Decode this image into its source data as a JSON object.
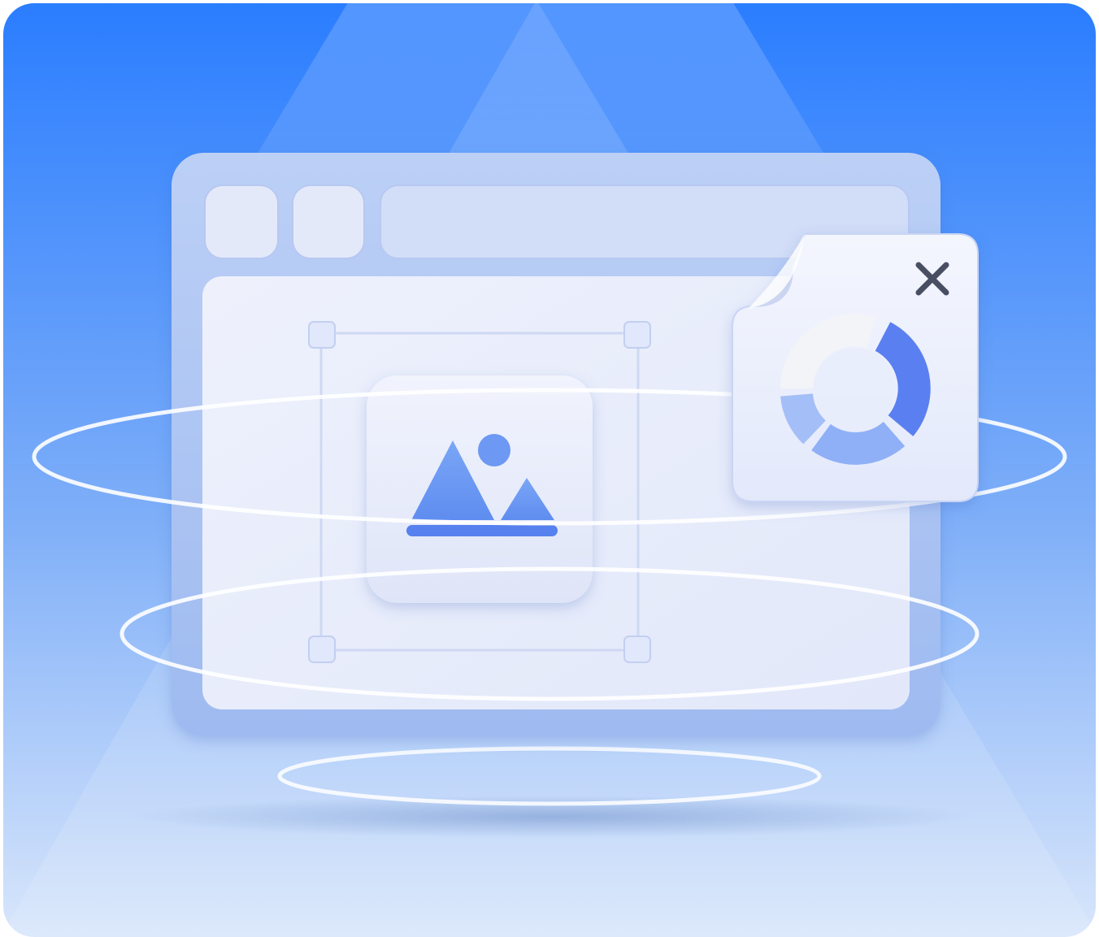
{
  "illustration": {
    "subject": "browser-window-with-image-and-chart-popup",
    "icons": {
      "window_button_1": "window-control-icon",
      "window_button_2": "window-control-icon",
      "address_bar": "address-bar",
      "image_placeholder": "image-icon",
      "popup_close": "close-icon",
      "popup_chart": "donut-chart-icon"
    },
    "colors": {
      "background_top": "#2a7dff",
      "background_bottom": "#d8e6fb",
      "window_frame": "#a9c3f3",
      "window_panel": "#e6ebfb",
      "accent_blue": "#4f78f0",
      "ring": "#ffffff"
    }
  }
}
